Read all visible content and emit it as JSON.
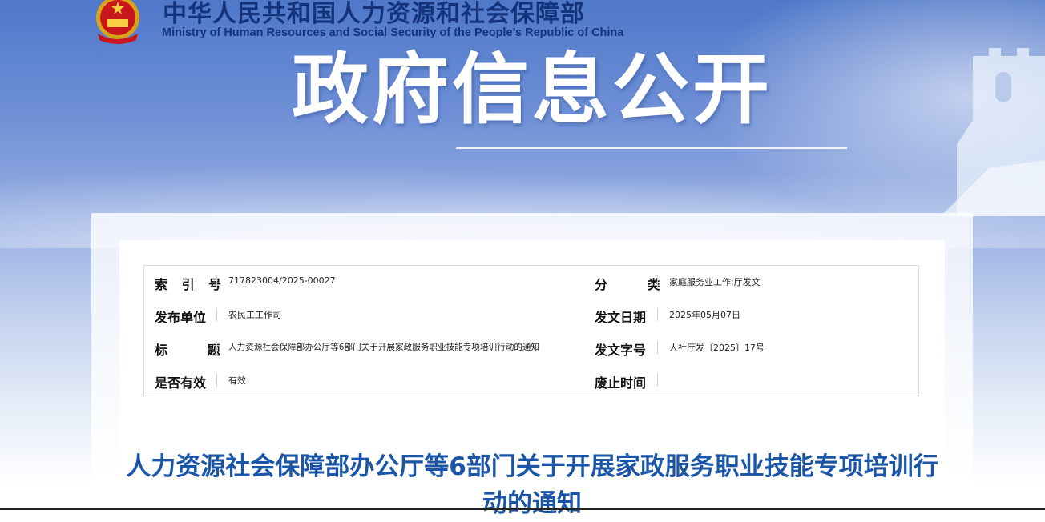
{
  "header": {
    "ministry_cn": "中华人民共和国人力资源和社会保障部",
    "ministry_en": "Ministry of Human Resources and Social Security of the People’s Republic of China",
    "banner_title": "政府信息公开"
  },
  "info": {
    "index_label": "索 引 号",
    "index_value": "717823004/2025-00027",
    "category_label": "分 类",
    "category_value": "家庭服务业工作;厅发文",
    "publisher_label": "发布单位",
    "publisher_value": "农民工工作司",
    "date_label": "发文日期",
    "date_value": "2025年05月07日",
    "title_label": "标 题",
    "title_value": "人力资源社会保障部办公厅等6部门关于开展家政服务职业技能专项培训行动的通知",
    "docno_label": "发文字号",
    "docno_value": "人社厅发〔2025〕17号",
    "valid_label": "是否有效",
    "valid_value": "有效",
    "expire_label": "废止时间",
    "expire_value": ""
  },
  "document": {
    "title": "人力资源社会保障部办公厅等6部门关于开展家政服务职业技能专项培训行动的通知"
  },
  "colors": {
    "banner_blue": "#4f78c9",
    "ministry_text": "#14337a",
    "doc_title": "#1a55a8"
  }
}
